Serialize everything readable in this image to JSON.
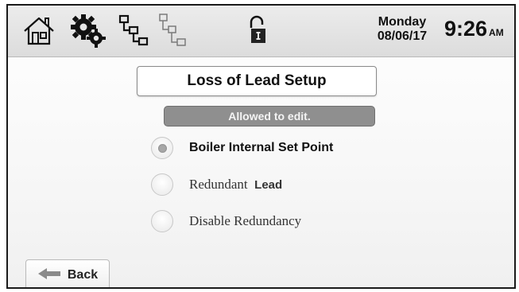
{
  "header": {
    "icons": [
      "home-icon",
      "settings-gears-icon",
      "network-icon",
      "network-secondary-icon",
      "lock-icon"
    ],
    "date": {
      "day": "Monday",
      "date": "08/06/17"
    },
    "time": {
      "value": "9:26",
      "ampm": "AM"
    }
  },
  "main": {
    "title": "Loss of Lead Setup",
    "status": "Allowed to edit.",
    "options": [
      {
        "label": "Boiler Internal Set Point",
        "selected": true
      },
      {
        "label_prefix": "Redundant",
        "label_bold": "Lead",
        "selected": false
      },
      {
        "label": "Disable Redundancy",
        "selected": false
      }
    ]
  },
  "footer": {
    "back_label": "Back",
    "back_icon": "back-arrow-icon"
  },
  "colors": {
    "status_bg": "#8f8f8f",
    "topbar_bg": "#e2e2e2"
  }
}
